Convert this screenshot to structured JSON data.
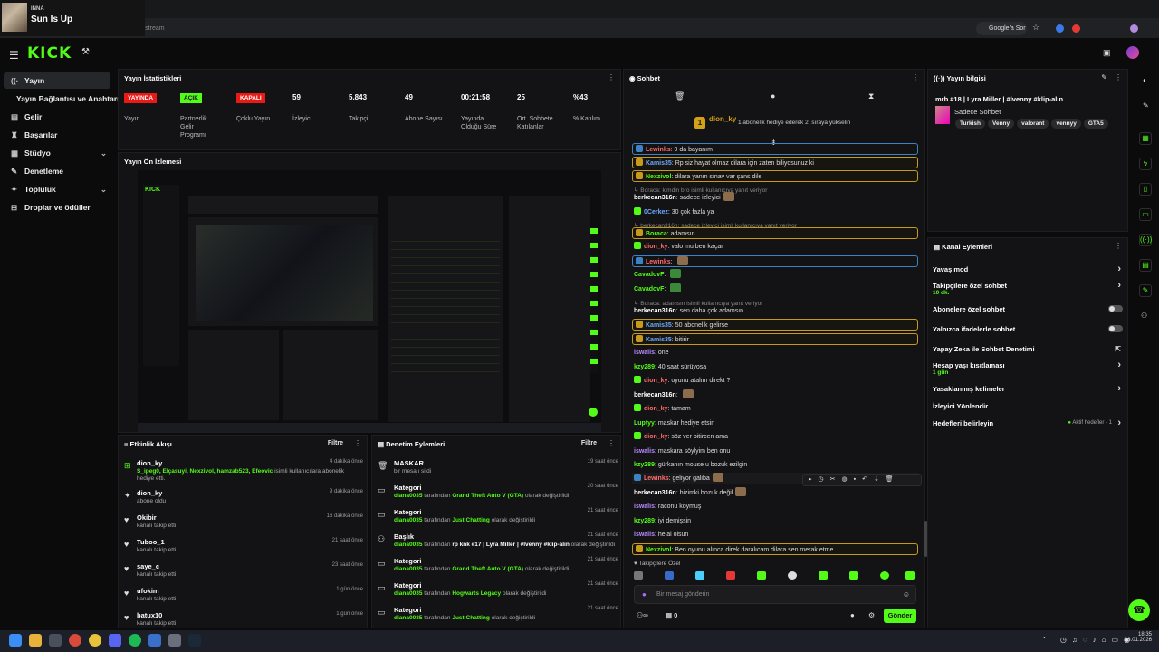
{
  "media": {
    "artist": "INNA",
    "song": "Sun Is Up"
  },
  "browser": {
    "url": "dashboard.kick.com/stream",
    "google_label": "Google'a Sor"
  },
  "brand": {
    "logo": "KICK",
    "accent": "#53fc18"
  },
  "sidebar": {
    "items": [
      {
        "label": "Yayın",
        "icon": "broadcast-icon"
      },
      {
        "label": "Yayın Bağlantısı ve Anahtarı",
        "icon": ""
      },
      {
        "label": "Gelir",
        "icon": "money-icon"
      },
      {
        "label": "Başarılar",
        "icon": "trophy-icon"
      },
      {
        "label": "Stüdyo",
        "icon": "studio-icon"
      },
      {
        "label": "Denetleme",
        "icon": "wrench-icon"
      },
      {
        "label": "Topluluk",
        "icon": "community-icon"
      },
      {
        "label": "Droplar ve ödüller",
        "icon": "gift-icon"
      }
    ]
  },
  "stats": {
    "title": "Yayın İstatistikleri",
    "items": [
      {
        "badge": "YAYINDA",
        "label": "Yayın",
        "color": "#e91916"
      },
      {
        "badge": "AÇIK",
        "label": "Partnerlik Gelir Programı",
        "color": "#53fc18"
      },
      {
        "badge": "KAPALI",
        "label": "Çoklu Yayın",
        "color": "#e91916"
      },
      {
        "value": "59",
        "label": "İzleyici"
      },
      {
        "value": "5.843",
        "label": "Takipçi"
      },
      {
        "value": "49",
        "label": "Abone Sayısı"
      },
      {
        "value": "00:21:58",
        "label": "Yayında Olduğu Süre"
      },
      {
        "value": "25",
        "label": "Ort. Sohbete Katılanlar"
      },
      {
        "value": "%43",
        "label": "% Katılım"
      }
    ]
  },
  "preview": {
    "title": "Yayın Ön İzlemesi"
  },
  "feed": {
    "title": "Etkinlik Akışı",
    "filter": "Filtre",
    "items": [
      {
        "name": "dion_ky",
        "sub_names": "S_ipeg0, Elçasuyi, Nexzivol, hamzab523, Efeovic",
        "sub_text": "isimli kullanıcılara abonelik hediye etti.",
        "time": "4 dakika önce",
        "icon": "gift-icon"
      },
      {
        "name": "dion_ky",
        "sub_text": "abone oldu",
        "time": "9 dakika önce",
        "icon": "star-icon"
      },
      {
        "name": "Okibir",
        "sub_text": "kanalı takip etti",
        "time": "16 dakika önce",
        "icon": "heart-icon"
      },
      {
        "name": "Tuboo_1",
        "sub_text": "kanalı takip etti",
        "time": "21 saat önce",
        "icon": "heart-icon"
      },
      {
        "name": "saye_c",
        "sub_text": "kanalı takip etti",
        "time": "23 saat önce",
        "icon": "heart-icon"
      },
      {
        "name": "ufokim",
        "sub_text": "kanalı takip etti",
        "time": "1 gün önce",
        "icon": "heart-icon"
      },
      {
        "name": "batux10",
        "sub_text": "kanalı takip etti",
        "time": "1 gün önce",
        "icon": "heart-icon"
      }
    ]
  },
  "mod": {
    "title": "Denetim Eylemleri",
    "filter": "Filtre",
    "items": [
      {
        "name": "MASKAR",
        "sub": "bir mesajı sildi",
        "user": "",
        "value": "",
        "tail": "",
        "time": "19 saat önce",
        "icon": "trash-icon"
      },
      {
        "name": "Kategori",
        "user": "diana0035",
        "mid": "tarafından",
        "value": "Grand Theft Auto V (GTA)",
        "tail": "olarak değiştirildi",
        "time": "20 saat önce",
        "icon": "category-icon"
      },
      {
        "name": "Kategori",
        "user": "diana0035",
        "mid": "tarafından",
        "value": "Just Chatting",
        "tail": "olarak değiştirildi",
        "time": "21 saat önce",
        "icon": "category-icon"
      },
      {
        "name": "Başlık",
        "user": "diana0035",
        "mid": "tarafından",
        "value": "rp knk #17 | Lyra Miller | #lvenny #klip-alın",
        "tail": "olarak değiştirildi",
        "time": "21 saat önce",
        "icon": "title-icon",
        "plain": true
      },
      {
        "name": "Kategori",
        "user": "diana0035",
        "mid": "tarafından",
        "value": "Grand Theft Auto V (GTA)",
        "tail": "olarak değiştirildi",
        "time": "21 saat önce",
        "icon": "category-icon"
      },
      {
        "name": "Kategori",
        "user": "diana0035",
        "mid": "tarafından",
        "value": "Hogwarts Legacy",
        "tail": "olarak değiştirildi",
        "time": "21 saat önce",
        "icon": "category-icon"
      },
      {
        "name": "Kategori",
        "user": "diana0035",
        "mid": "tarafından",
        "value": "Just Chatting",
        "tail": "olarak değiştirildi",
        "time": "21 saat önce",
        "icon": "category-icon"
      }
    ]
  },
  "chat": {
    "title": "Sohbet",
    "pinned_user": "dion_ky",
    "pinned_text": "1 abonelik hediye ederek 2. sıraya yükselin",
    "pinned_rank": "1",
    "followers_label": "Takipçilere Özel",
    "input_placeholder": "Bir mesaj gönderin",
    "send": "Gönder",
    "count": "0",
    "messages": [
      {
        "user": "Lewinks",
        "color": "#ff6b6b",
        "text": "9 da bayanım",
        "style": "hl2",
        "badge": "#3b83c4"
      },
      {
        "user": "Kamis35",
        "color": "#6ea8ff",
        "text": "Rp siz hayat olmaz dilara için zaten biliyosunuz ki",
        "style": "hl",
        "badge": "#c79a1b"
      },
      {
        "user": "Nexzivol",
        "color": "#53fc18",
        "text": "dilara yanın sınav var şans dile",
        "style": "hl",
        "badge": "#c79a1b"
      },
      {
        "reply": "Boraca: kimdin bro isimli kullanıcıya yanıt veriyor"
      },
      {
        "user": "berkecan316n",
        "color": "#fff",
        "text": "sadece izleyici",
        "emote": true
      },
      {
        "user": "0Cerkez",
        "color": "#6ea8ff",
        "text": "30 çok fazla ya",
        "badge": "#53fc18"
      },
      {
        "reply": "berkecan316n: sadece izleyici isimli kullanıcıya yanıt veriyor"
      },
      {
        "user": "Boraca",
        "color": "#53fc18",
        "text": "adamsın",
        "style": "hl",
        "badge": "#c79a1b"
      },
      {
        "user": "dion_ky",
        "color": "#ff6b6b",
        "text": "valo mu ben kaçar",
        "badge": "#53fc18"
      },
      {
        "user": "Lewinks",
        "color": "#ff6b6b",
        "text": "",
        "emote": true,
        "style": "hl2",
        "badge": "#3b83c4"
      },
      {
        "user": "CavadovF",
        "color": "#53fc18",
        "text": ""
      },
      {
        "user": "CavadovF",
        "color": "#53fc18",
        "text": ""
      },
      {
        "reply": "Boraca: adamsın isimli kullanıcıya yanıt veriyor"
      },
      {
        "user": "berkecan316n",
        "color": "#fff",
        "text": "sen daha çok adamsın"
      },
      {
        "user": "Kamis35",
        "color": "#6ea8ff",
        "text": "50 abonelik gelirse",
        "style": "hl",
        "badge": "#c79a1b"
      },
      {
        "user": "Kamis35",
        "color": "#6ea8ff",
        "text": "bitirir",
        "style": "hl",
        "badge": "#c79a1b"
      },
      {
        "user": "iswalis",
        "color": "#b989ff",
        "text": "öne"
      },
      {
        "user": "kzy289",
        "color": "#53fc18",
        "text": "40 saat sürüyosa"
      },
      {
        "user": "dion_ky",
        "color": "#ff6b6b",
        "text": "oyunu atalım direkt ?",
        "badge": "#53fc18"
      },
      {
        "user": "berkecan316n",
        "color": "#fff",
        "text": "",
        "emote": true
      },
      {
        "user": "dion_ky",
        "color": "#ff6b6b",
        "text": "tamam",
        "badge": "#53fc18"
      },
      {
        "user": "Luptyy",
        "color": "#53fc18",
        "text": "maskar hediye etsin"
      },
      {
        "user": "dion_ky",
        "color": "#ff6b6b",
        "text": "söz ver bitircen ama",
        "badge": "#53fc18"
      },
      {
        "user": "iswalis",
        "color": "#b989ff",
        "text": "maskara söylyim ben onu"
      },
      {
        "user": "kzy289",
        "color": "#53fc18",
        "text": "gürkanın mouse u bozuk ezilgin"
      },
      {
        "user": "Lewinks",
        "color": "#ff6b6b",
        "text": "geliyor galiba",
        "emote": true,
        "style": "hover",
        "badge": "#3b83c4"
      },
      {
        "user": "berkecan316n",
        "color": "#fff",
        "text": "bizimki bozuk değil",
        "emote": true
      },
      {
        "user": "iswalis",
        "color": "#b989ff",
        "text": "raconu koymuş"
      },
      {
        "user": "kzy289",
        "color": "#53fc18",
        "text": "iyi demişsin"
      },
      {
        "user": "iswalis",
        "color": "#b989ff",
        "text": "helal olsun"
      },
      {
        "user": "Nexzivol",
        "color": "#53fc18",
        "text": "Ben oyunu alınca direk daralıcam dilara sen merak etme",
        "style": "hl",
        "badge": "#c79a1b"
      }
    ]
  },
  "info": {
    "title": "Yayın bilgisi",
    "stream_title": "mrb #18 | Lyra Miller | #lvenny #klip-alın",
    "chat_mode": "Sadece Sohbet",
    "tags": [
      "Turkish",
      "Venny",
      "valorant",
      "vennyy",
      "GTA5"
    ]
  },
  "actions": {
    "title": "Kanal Eylemleri",
    "items": [
      {
        "label": "Yavaş mod",
        "kind": "arrow"
      },
      {
        "label": "Takipçilere özel sohbet",
        "sub": "10 dk.",
        "kind": "arrow"
      },
      {
        "label": "Abonelere özel sohbet",
        "kind": "toggle"
      },
      {
        "label": "Yalnızca ifadelerle sohbet",
        "kind": "toggle"
      },
      {
        "label": "Yapay Zeka ile Sohbet Denetimi",
        "kind": "link"
      },
      {
        "label": "Hesap yaşı kısıtlaması",
        "sub": "1 gün",
        "kind": "arrow"
      },
      {
        "label": "Yasaklanmış kelimeler",
        "kind": "arrow"
      },
      {
        "label": "İzleyici Yönlendir",
        "kind": "none"
      },
      {
        "label": "Hedefleri belirleyin",
        "extra": "Aktif hedefler - 1",
        "kind": "arrow"
      }
    ]
  },
  "taskbar": {
    "time": "18:35",
    "date": "18.01.2026"
  }
}
